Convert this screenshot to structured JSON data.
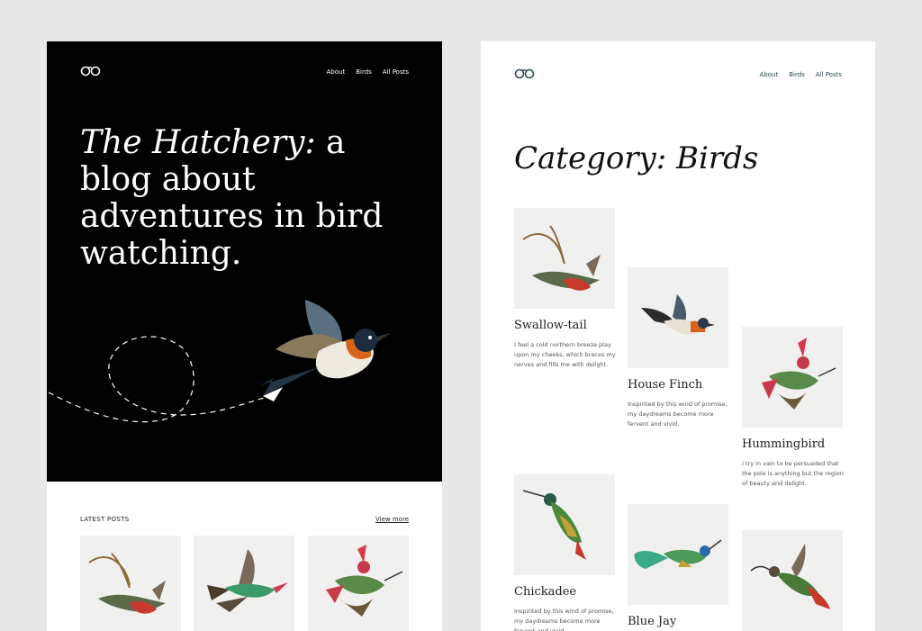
{
  "left_page": {
    "nav": [
      "About",
      "Birds",
      "All Posts"
    ],
    "hero": {
      "title_italic": "The Hatchery:",
      "title_rest": " a blog about adventures in bird watching."
    },
    "latest": {
      "label": "LATEST POSTS",
      "view_more": "View more"
    }
  },
  "right_page": {
    "nav": [
      "About",
      "Birds",
      "All Posts"
    ],
    "category_title": "Category: Birds",
    "posts": [
      {
        "title": "Swallow-tail",
        "excerpt": "I feel a cold northern breeze play upon my cheeks, which braces my nerves and fills me with delight."
      },
      {
        "title": "House Finch",
        "excerpt": "Inspirited by this wind of promise, my daydreams become more fervent and vivid."
      },
      {
        "title": "Hummingbird",
        "excerpt": "I try in vain to be persuaded that the pole is anything but the region of beauty and delight."
      },
      {
        "title": "Chickadee",
        "excerpt": "Inspirited by this wind of promise, my daydreams become more fervent and vivid."
      },
      {
        "title": "Blue Jay",
        "excerpt": ""
      }
    ]
  },
  "colors": {
    "page_background": "#e8e8e8",
    "hero_background": "#000000",
    "thumbnail_background": "#f0f0ee",
    "nav_link_right": "#2c4a52"
  },
  "icons": [
    "logo-glasses-icon",
    "bird-illustration"
  ]
}
